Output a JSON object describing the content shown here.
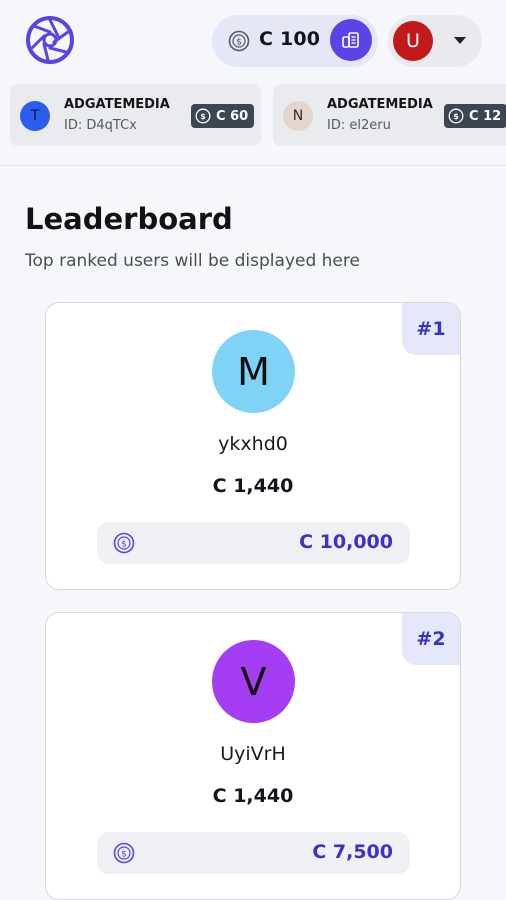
{
  "header": {
    "balance": "C 100",
    "user_initial": "U",
    "colors": {
      "accent": "#5a43e8",
      "user_avatar": "#c21a1a"
    }
  },
  "activity_feed": [
    {
      "initial": "T",
      "avatar_color": "#2b5ef0",
      "name": "ADGATEMEDIA",
      "id": "ID: D4qTCx",
      "amount": "C 60"
    },
    {
      "initial": "N",
      "avatar_color": "#e4d6cf",
      "name": "ADGATEMEDIA",
      "id": "ID: el2eru",
      "amount": "C 12"
    }
  ],
  "leaderboard": {
    "title": "Leaderboard",
    "subtitle": "Top ranked users will be displayed here",
    "entries": [
      {
        "rank": "#1",
        "initial": "M",
        "avatar_color": "#7fd3f7",
        "username": "ykxhd0",
        "score": "C 1,440",
        "prize": "C 10,000"
      },
      {
        "rank": "#2",
        "initial": "V",
        "avatar_color": "#a53df2",
        "username": "UyiVrH",
        "score": "C 1,440",
        "prize": "C 7,500"
      }
    ]
  },
  "icons": {
    "logo": "aperture-logo-icon",
    "coin": "coin-icon",
    "wallet": "wallet-icon",
    "dropdown": "chevron-down-icon"
  }
}
